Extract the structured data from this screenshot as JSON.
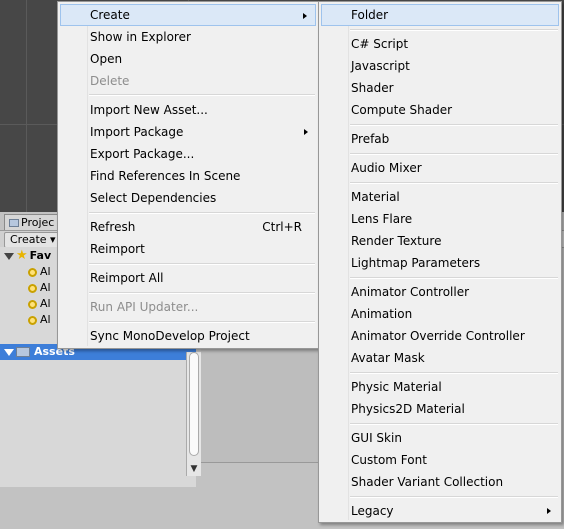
{
  "project_panel": {
    "tab_label": "Projec",
    "create_button_label": "Create ▾",
    "favorites_label": "Fav",
    "favorite_items": [
      "Al",
      "Al",
      "Al",
      "Al"
    ],
    "assets_label": "Assets",
    "scroll_down_glyph": "▼"
  },
  "context_menu": {
    "items": [
      {
        "label": "Create"
      },
      {
        "label": "Show in Explorer"
      },
      {
        "label": "Open"
      },
      {
        "label": "Delete"
      },
      {
        "label": "Import New Asset..."
      },
      {
        "label": "Import Package"
      },
      {
        "label": "Export Package..."
      },
      {
        "label": "Find References In Scene"
      },
      {
        "label": "Select Dependencies"
      },
      {
        "label": "Refresh",
        "shortcut": "Ctrl+R"
      },
      {
        "label": "Reimport"
      },
      {
        "label": "Reimport All"
      },
      {
        "label": "Run API Updater..."
      },
      {
        "label": "Sync MonoDevelop Project"
      }
    ]
  },
  "create_submenu": {
    "items": [
      {
        "label": "Folder"
      },
      {
        "label": "C# Script"
      },
      {
        "label": "Javascript"
      },
      {
        "label": "Shader"
      },
      {
        "label": "Compute Shader"
      },
      {
        "label": "Prefab"
      },
      {
        "label": "Audio Mixer"
      },
      {
        "label": "Material"
      },
      {
        "label": "Lens Flare"
      },
      {
        "label": "Render Texture"
      },
      {
        "label": "Lightmap Parameters"
      },
      {
        "label": "Animator Controller"
      },
      {
        "label": "Animation"
      },
      {
        "label": "Animator Override Controller"
      },
      {
        "label": "Avatar Mask"
      },
      {
        "label": "Physic Material"
      },
      {
        "label": "Physics2D Material"
      },
      {
        "label": "GUI Skin"
      },
      {
        "label": "Custom Font"
      },
      {
        "label": "Shader Variant Collection"
      },
      {
        "label": "Legacy"
      }
    ]
  },
  "colors": {
    "menu_background": "#f0f0f0",
    "highlight": "#dbe8f7",
    "selection_blue": "#3d7ed9",
    "disabled_text": "#8d8d8d"
  }
}
